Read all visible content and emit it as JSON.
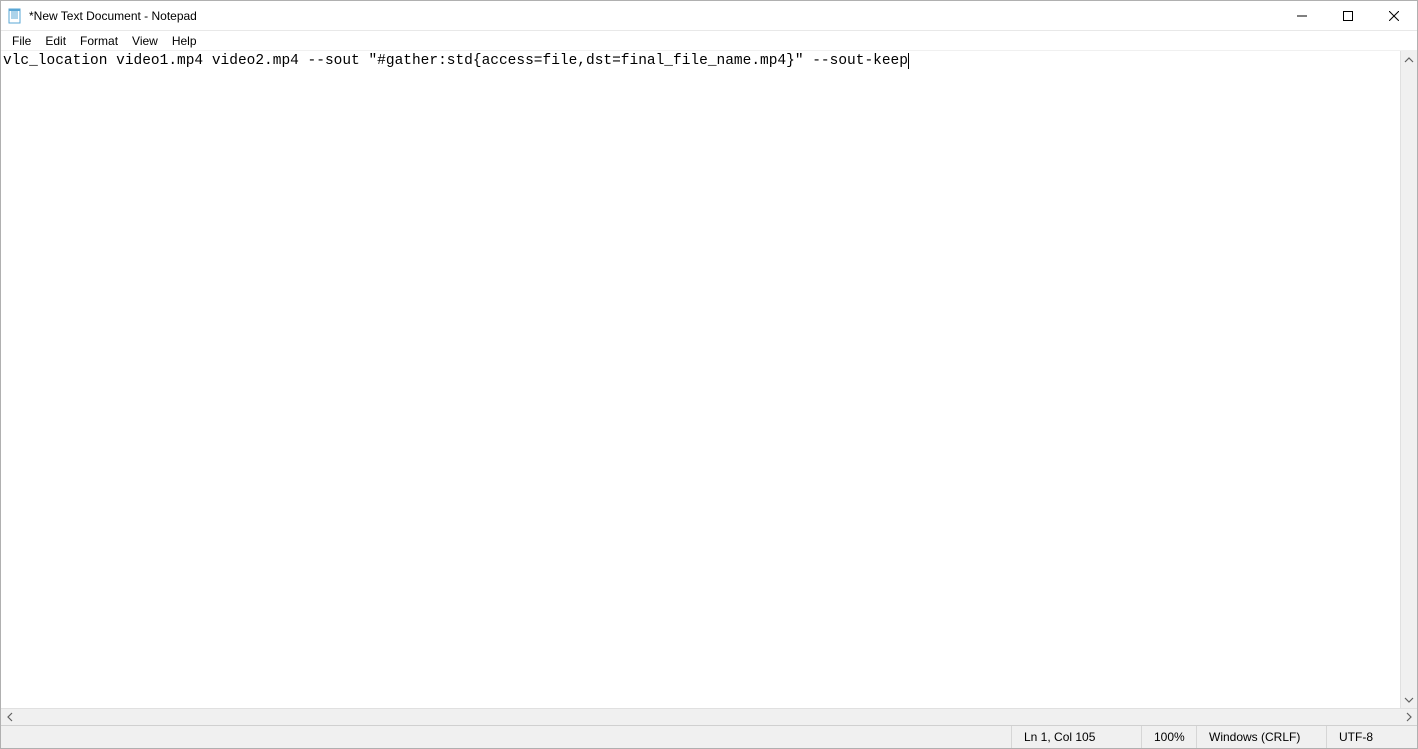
{
  "title": "*New Text Document - Notepad",
  "menu": {
    "file": "File",
    "edit": "Edit",
    "format": "Format",
    "view": "View",
    "help": "Help"
  },
  "editor": {
    "content": "vlc_location video1.mp4 video2.mp4 --sout \"#gather:std{access=file,dst=final_file_name.mp4}\" --sout-keep"
  },
  "status": {
    "position": "Ln 1, Col 105",
    "zoom": "100%",
    "eol": "Windows (CRLF)",
    "encoding": "UTF-8"
  }
}
